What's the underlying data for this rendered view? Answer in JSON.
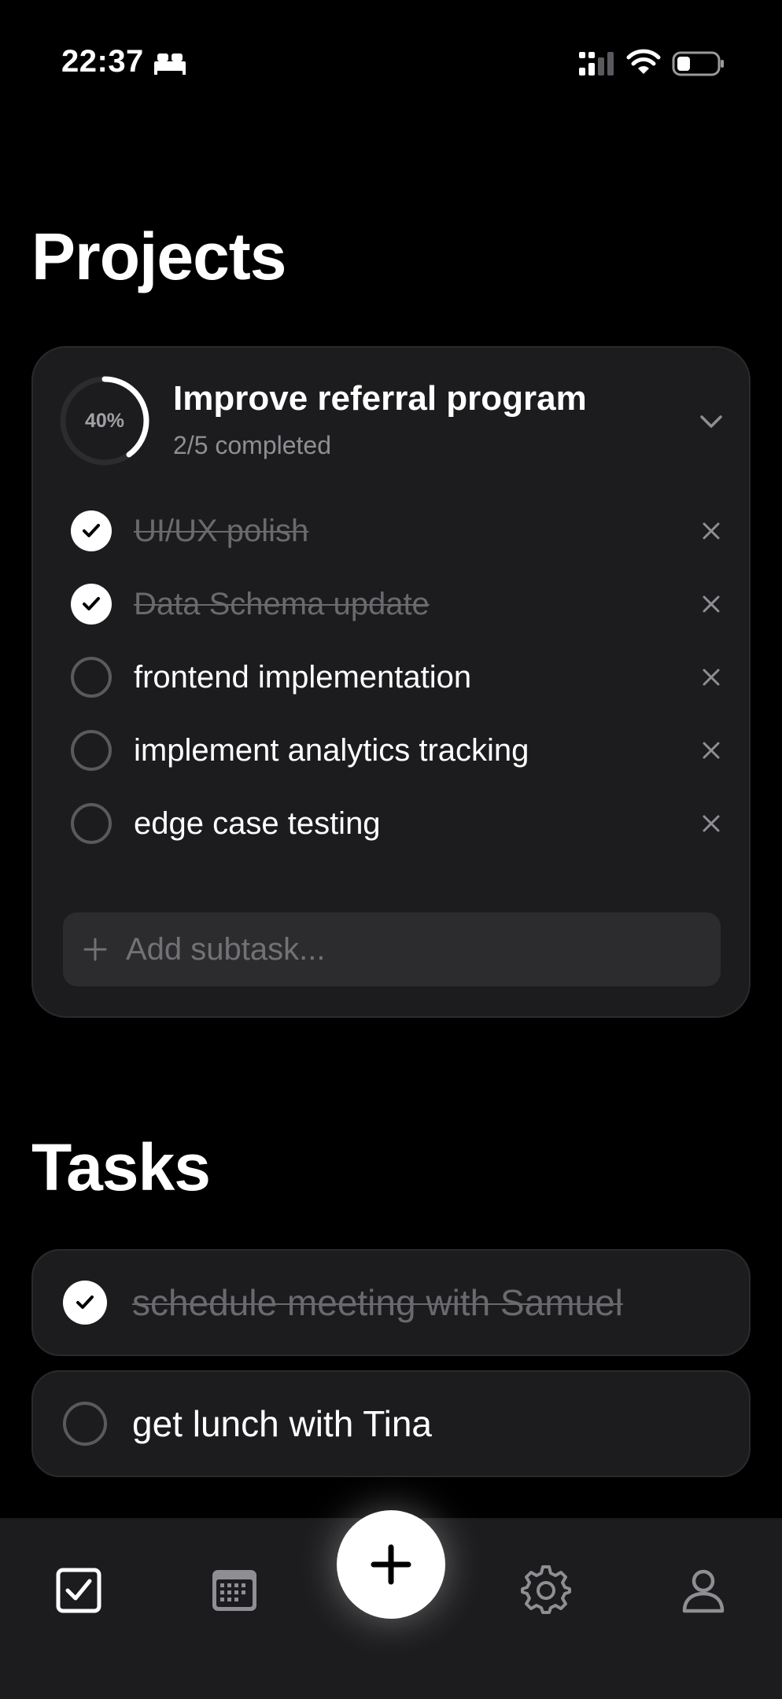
{
  "status_bar": {
    "time": "22:37"
  },
  "projects": {
    "title": "Projects",
    "items": [
      {
        "name": "Improve referral program",
        "progress_percent": 40,
        "progress_label": "40%",
        "completed_text": "2/5 completed",
        "expanded": true,
        "subtasks": [
          {
            "label": "UI/UX polish",
            "done": true
          },
          {
            "label": "Data Schema update",
            "done": true
          },
          {
            "label": "frontend implementation",
            "done": false
          },
          {
            "label": "implement analytics tracking",
            "done": false
          },
          {
            "label": "edge case testing",
            "done": false
          }
        ],
        "add_subtask_placeholder": "Add subtask..."
      }
    ]
  },
  "tasks": {
    "title": "Tasks",
    "items": [
      {
        "label": "schedule meeting with Samuel",
        "done": true
      },
      {
        "label": "get lunch with Tina",
        "done": false
      }
    ]
  },
  "tab_bar": {
    "items": [
      {
        "icon": "checkbox-icon",
        "selected": true
      },
      {
        "icon": "calendar-icon",
        "selected": false
      },
      {
        "icon": "plus-icon",
        "primary": true
      },
      {
        "icon": "gear-icon",
        "selected": false
      },
      {
        "icon": "person-icon",
        "selected": false
      }
    ]
  },
  "colors": {
    "background": "#000000",
    "card": "#1c1c1e",
    "input": "#2c2c2e",
    "text_primary": "#ffffff",
    "text_secondary": "#8e8e93",
    "text_done": "#6a6a6e"
  }
}
